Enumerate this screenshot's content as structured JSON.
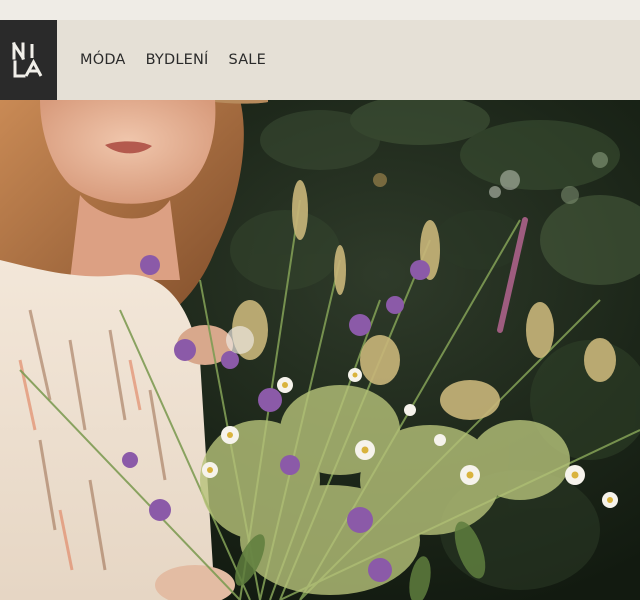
{
  "brand": {
    "logo_text": "NILA"
  },
  "nav": {
    "items": [
      {
        "label": "MÓDA"
      },
      {
        "label": "BYDLENÍ"
      },
      {
        "label": "SALE"
      }
    ]
  },
  "hero": {
    "image_subject": "woman-holding-wildflower-bouquet"
  },
  "colors": {
    "header_bg": "#e5e0d6",
    "logo_bg": "#2a2a2a",
    "nav_text": "#2b2b2b",
    "page_bg": "#efece6"
  }
}
